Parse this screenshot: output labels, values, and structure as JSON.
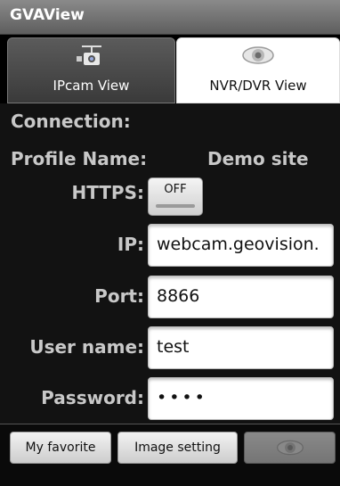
{
  "app": {
    "title": "GVAView"
  },
  "tabs": [
    {
      "label": "IPcam View",
      "icon": "camera-icon"
    },
    {
      "label": "NVR/DVR View",
      "icon": "eye-icon"
    }
  ],
  "form": {
    "connection_label": "Connection:",
    "profile_label": "Profile Name:",
    "profile_value": "Demo site",
    "https_label": "HTTPS:",
    "https_state": "OFF",
    "ip_label": "IP:",
    "ip_value": "webcam.geovision.",
    "port_label": "Port:",
    "port_value": "8866",
    "username_label": "User name:",
    "username_value": "test",
    "password_label": "Password:",
    "password_value": "••••"
  },
  "bottom": {
    "favorite": "My favorite",
    "image_setting": "Image setting",
    "view_icon": "eye-icon"
  }
}
